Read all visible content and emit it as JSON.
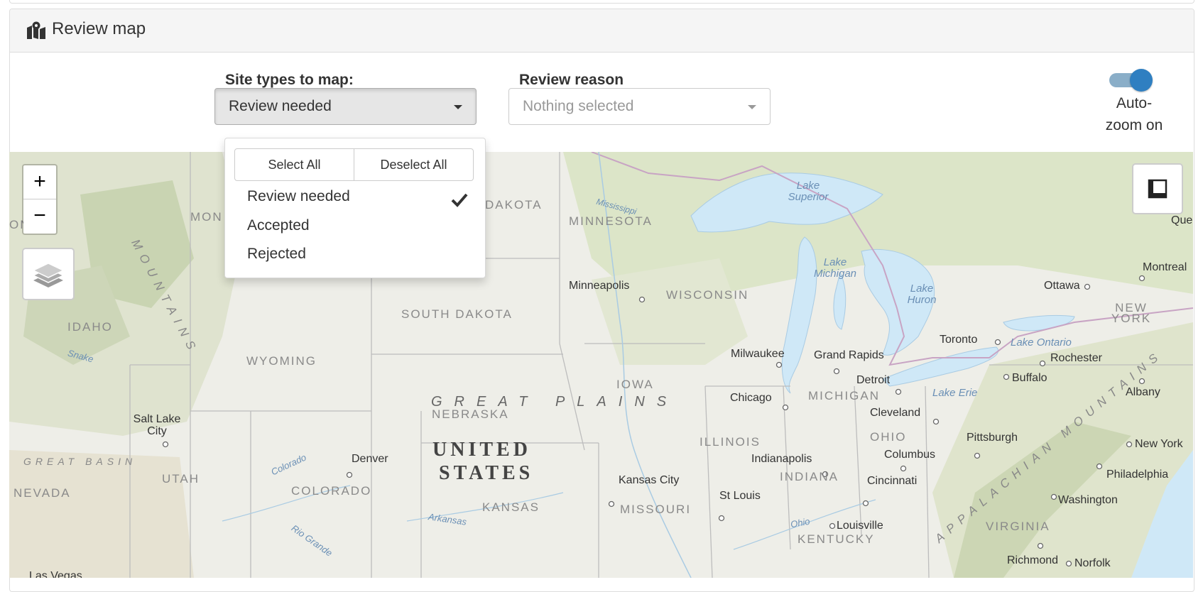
{
  "panel": {
    "title": "Review map",
    "title_icon": "map-location-icon"
  },
  "filters": {
    "site_types": {
      "label": "Site types to map:",
      "selected": "Review needed"
    },
    "review_reason": {
      "label": "Review reason",
      "placeholder": "Nothing selected"
    }
  },
  "autozoom": {
    "label": "Auto-zoom on",
    "enabled": true
  },
  "dropdown": {
    "select_all": "Select All",
    "deselect_all": "Deselect All",
    "options": [
      {
        "label": "Review needed",
        "checked": true
      },
      {
        "label": "Accepted",
        "checked": false
      },
      {
        "label": "Rejected",
        "checked": false
      }
    ]
  },
  "map_controls": {
    "zoom_in": "+",
    "zoom_out": "−",
    "layers_icon": "layers-icon",
    "measure_icon": "ruler-square-icon"
  },
  "map_labels": {
    "countries": [
      "UNITED",
      "STATES"
    ],
    "regions": [
      "GREAT PLAINS",
      "MOUNTAINS",
      "APPALACHIAN MOUNTAINS",
      "GREAT BASIN"
    ],
    "states": [
      "MINNESOTA",
      "WISCONSIN",
      "SOUTH DAKOTA",
      "IDAHO",
      "WYOMING",
      "IOWA",
      "NEBRASKA",
      "ILLINOIS",
      "MICHIGAN",
      "OHIO",
      "INDIANA",
      "COLORADO",
      "UTAH",
      "NEVADA",
      "KANSAS",
      "MISSOURI",
      "KENTUCKY",
      "VIRGINIA",
      "NEW YORK",
      "DAKOTA",
      "MON",
      "ON"
    ],
    "water": [
      "Lake Superior",
      "Lake Michigan",
      "Lake Huron",
      "Lake Ontario",
      "Lake Erie",
      "Mississippi",
      "Snake",
      "Colorado",
      "Arkansas",
      "Rio Grande",
      "Ohio"
    ],
    "cities": [
      "Minneapolis",
      "Milwaukee",
      "Grand Rapids",
      "Detroit",
      "Chicago",
      "Toronto",
      "Rochester",
      "Buffalo",
      "Albany",
      "Ottawa",
      "Montreal",
      "Cleveland",
      "Pittsburgh",
      "Columbus",
      "Indianapolis",
      "Cincinnati",
      "Kansas City",
      "St Louis",
      "Louisville",
      "Denver",
      "Salt Lake City",
      "New York",
      "Philadelphia",
      "Washington",
      "Richmond",
      "Norfolk",
      "Que",
      "Las Vegas"
    ]
  },
  "colors": {
    "accent": "#2f7fc1",
    "water": "#cfe8f7",
    "land": "#eeeee8"
  }
}
